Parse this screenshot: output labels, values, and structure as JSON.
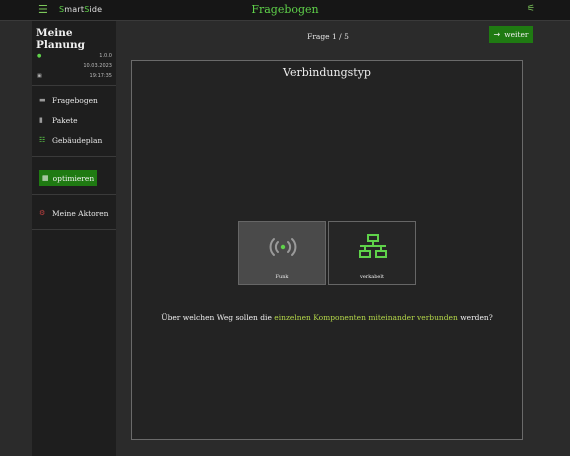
{
  "topbar": {
    "menu_icon": "hamburger-menu-icon",
    "logo_parts": [
      "S",
      "mart",
      "S",
      "ide"
    ],
    "title": "Fragebogen",
    "settings_icon": "sliders-icon",
    "accent_color": "#5fd24a"
  },
  "sidebar": {
    "plan_title": "Meine Planung",
    "version": "1.0.0",
    "date": "10.03.2023",
    "time": "19:17:35",
    "nav_items": [
      {
        "label": "Fragebogen",
        "icon": "questionnaire-icon"
      },
      {
        "label": "Pakete",
        "icon": "package-icon"
      },
      {
        "label": "Gebäudeplan",
        "icon": "floorplan-icon"
      }
    ],
    "optimize_label": "optimieren",
    "actors_label": "Meine Aktoren"
  },
  "main": {
    "counter": "Frage 1 / 5",
    "next_label": "weiter",
    "card_title": "Verbindungstyp",
    "options": [
      {
        "label": "Funk",
        "icon": "wireless-signal-icon",
        "selected": true
      },
      {
        "label": "verkabelt",
        "icon": "wired-network-icon",
        "selected": false
      }
    ],
    "question_prefix": "Über welchen Weg sollen die ",
    "question_highlight": "einzelnen Komponenten miteinander verbunden",
    "question_suffix": " werden?"
  }
}
